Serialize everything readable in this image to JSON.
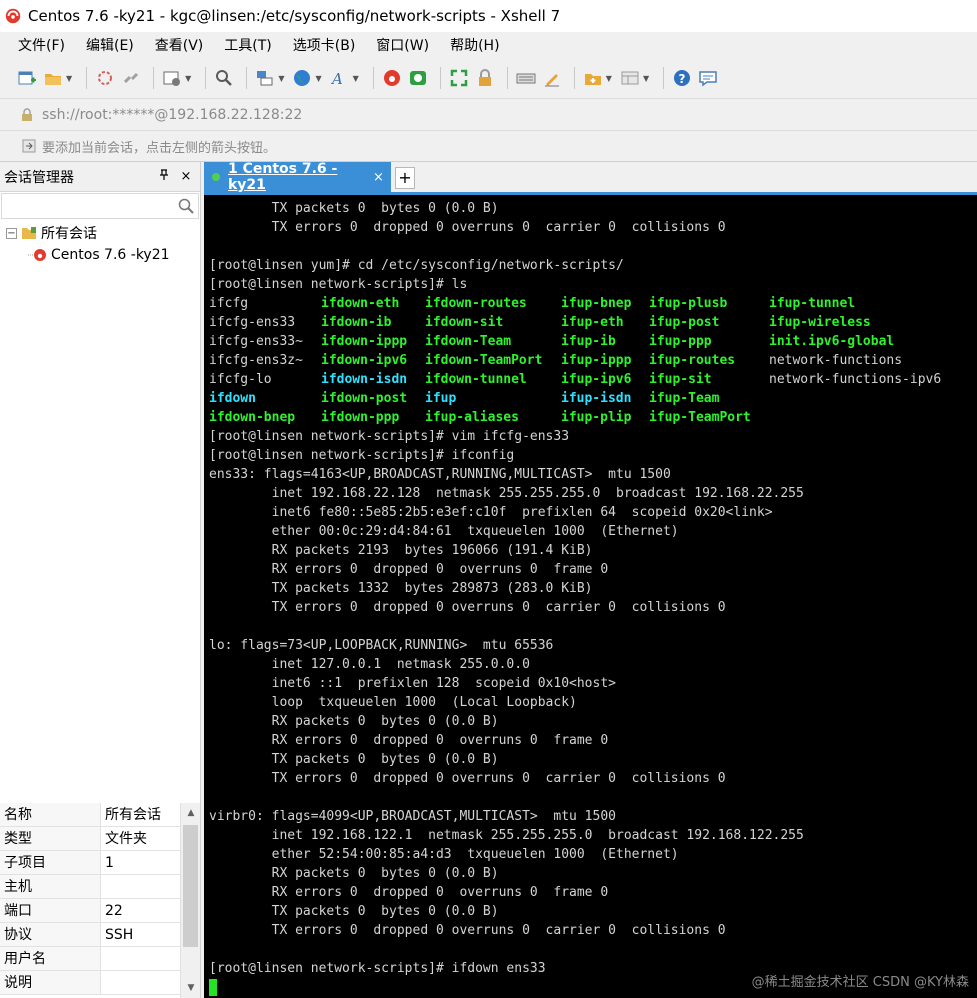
{
  "window": {
    "title": "Centos 7.6 -ky21 - kgc@linsen:/etc/sysconfig/network-scripts - Xshell 7"
  },
  "menu": [
    "文件(F)",
    "编辑(E)",
    "查看(V)",
    "工具(T)",
    "选项卡(B)",
    "窗口(W)",
    "帮助(H)"
  ],
  "address": {
    "value": "ssh://root:******@192.168.22.128:22"
  },
  "hint": {
    "text": "要添加当前会话，点击左侧的箭头按钮。"
  },
  "session_manager": {
    "title": "会话管理器",
    "pin": "ㅍ",
    "close": "×",
    "tree": {
      "root_label": "所有会话",
      "child_label": "Centos 7.6 -ky21"
    },
    "properties": [
      {
        "key": "名称",
        "value": "所有会话"
      },
      {
        "key": "类型",
        "value": "文件夹"
      },
      {
        "key": "子项目",
        "value": "1"
      },
      {
        "key": "主机",
        "value": ""
      },
      {
        "key": "端口",
        "value": "22"
      },
      {
        "key": "协议",
        "value": "SSH"
      },
      {
        "key": "用户名",
        "value": ""
      },
      {
        "key": "说明",
        "value": ""
      }
    ]
  },
  "tabs": {
    "active": "1 Centos 7.6 -ky21",
    "close": "×",
    "new": "+"
  },
  "terminal": {
    "lines_top": [
      "        TX packets 0  bytes 0 (0.0 B)",
      "        TX errors 0  dropped 0 overruns 0  carrier 0  collisions 0",
      "",
      "[root@linsen yum]# cd /etc/sysconfig/network-scripts/",
      "[root@linsen network-scripts]# ls"
    ],
    "ls_rows": [
      [
        "ifcfg",
        "ifdown-eth",
        "ifdown-routes",
        "ifup-bnep",
        "ifup-plusb",
        "ifup-tunnel"
      ],
      [
        "ifcfg-ens33",
        "ifdown-ib",
        "ifdown-sit",
        "ifup-eth",
        "ifup-post",
        "ifup-wireless"
      ],
      [
        "ifcfg-ens33~",
        "ifdown-ippp",
        "ifdown-Team",
        "ifup-ib",
        "ifup-ppp",
        "init.ipv6-global"
      ],
      [
        "ifcfg-ens3z~",
        "ifdown-ipv6",
        "ifdown-TeamPort",
        "ifup-ippp",
        "ifup-routes",
        "network-functions"
      ],
      [
        "ifcfg-lo",
        "ifdown-isdn",
        "ifdown-tunnel",
        "ifup-ipv6",
        "ifup-sit",
        "network-functions-ipv6"
      ],
      [
        "ifdown",
        "ifdown-post",
        "ifup",
        "ifup-isdn",
        "ifup-Team",
        ""
      ],
      [
        "ifdown-bnep",
        "ifdown-ppp",
        "ifup-aliases",
        "ifup-plip",
        "ifup-TeamPort",
        ""
      ]
    ],
    "ls_colors": [
      [
        "w",
        "g",
        "g",
        "g",
        "g",
        "g"
      ],
      [
        "w",
        "g",
        "g",
        "g",
        "g",
        "g"
      ],
      [
        "w",
        "g",
        "g",
        "g",
        "g",
        "g"
      ],
      [
        "w",
        "g",
        "g",
        "g",
        "g",
        "w"
      ],
      [
        "w",
        "c",
        "g",
        "g",
        "g",
        "w"
      ],
      [
        "c",
        "g",
        "c",
        "c",
        "g",
        "w"
      ],
      [
        "g",
        "g",
        "g",
        "g",
        "g",
        "w"
      ]
    ],
    "lines_bottom": [
      "[root@linsen network-scripts]# vim ifcfg-ens33",
      "[root@linsen network-scripts]# ifconfig",
      "ens33: flags=4163<UP,BROADCAST,RUNNING,MULTICAST>  mtu 1500",
      "        inet 192.168.22.128  netmask 255.255.255.0  broadcast 192.168.22.255",
      "        inet6 fe80::5e85:2b5:e3ef:c10f  prefixlen 64  scopeid 0x20<link>",
      "        ether 00:0c:29:d4:84:61  txqueuelen 1000  (Ethernet)",
      "        RX packets 2193  bytes 196066 (191.4 KiB)",
      "        RX errors 0  dropped 0  overruns 0  frame 0",
      "        TX packets 1332  bytes 289873 (283.0 KiB)",
      "        TX errors 0  dropped 0 overruns 0  carrier 0  collisions 0",
      "",
      "lo: flags=73<UP,LOOPBACK,RUNNING>  mtu 65536",
      "        inet 127.0.0.1  netmask 255.0.0.0",
      "        inet6 ::1  prefixlen 128  scopeid 0x10<host>",
      "        loop  txqueuelen 1000  (Local Loopback)",
      "        RX packets 0  bytes 0 (0.0 B)",
      "        RX errors 0  dropped 0  overruns 0  frame 0",
      "        TX packets 0  bytes 0 (0.0 B)",
      "        TX errors 0  dropped 0 overruns 0  carrier 0  collisions 0",
      "",
      "virbr0: flags=4099<UP,BROADCAST,MULTICAST>  mtu 1500",
      "        inet 192.168.122.1  netmask 255.255.255.0  broadcast 192.168.122.255",
      "        ether 52:54:00:85:a4:d3  txqueuelen 1000  (Ethernet)",
      "        RX packets 0  bytes 0 (0.0 B)",
      "        RX errors 0  dropped 0  overruns 0  frame 0",
      "        TX packets 0  bytes 0 (0.0 B)",
      "        TX errors 0  dropped 0 overruns 0  carrier 0  collisions 0",
      "",
      "[root@linsen network-scripts]# ifdown ens33"
    ]
  },
  "watermark": "@稀土掘金技术社区 CSDN @KY林森",
  "colors": {
    "tab_active": "#3b8fd6",
    "ls_green": "#2ef22e",
    "ls_cyan": "#2ee2ff",
    "cursor": "#24e224",
    "terminal_bg": "#000000"
  }
}
